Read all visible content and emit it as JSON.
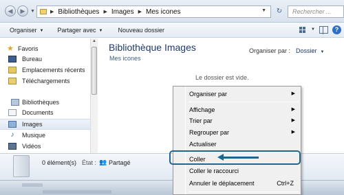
{
  "address": {
    "crumbs": [
      "Bibliothèques",
      "Images",
      "Mes icones"
    ],
    "search_placeholder": "Rechercher ..."
  },
  "toolbar": {
    "organize": "Organiser",
    "share": "Partager avec",
    "new_folder": "Nouveau dossier"
  },
  "sidebar": {
    "favorites": {
      "label": "Favoris",
      "items": [
        "Bureau",
        "Emplacements récents",
        "Téléchargements"
      ]
    },
    "libraries": {
      "label": "Bibliothèques",
      "items": [
        "Documents",
        "Images",
        "Musique",
        "Vidéos"
      ]
    },
    "selected": "Images"
  },
  "content": {
    "title": "Bibliothèque Images",
    "subtitle": "Mes icones",
    "arrange_label": "Organiser par :",
    "arrange_value": "Dossier",
    "empty_message": "Le dossier est vide."
  },
  "details": {
    "count": "0 élément(s)",
    "state_label": "État :",
    "state_value": "Partagé"
  },
  "context_menu": {
    "arrange_by": "Organiser par",
    "view": "Affichage",
    "sort_by": "Trier par",
    "group_by": "Regrouper par",
    "refresh": "Actualiser",
    "paste": "Coller",
    "paste_shortcut": "Coller le raccourci",
    "undo_move": "Annuler le déplacement",
    "undo_shortcut": "Ctrl+Z"
  },
  "colors": {
    "annotation": "#1d6690",
    "title_blue": "#1f3a6b",
    "folder_yellow": "#f0d070"
  },
  "icons": {
    "back": "back-arrow-icon",
    "forward": "forward-arrow-icon",
    "refresh": "refresh-icon",
    "search": "search-icon",
    "favorites": "star-icon",
    "libraries": "library-icon",
    "help": "help-icon"
  }
}
